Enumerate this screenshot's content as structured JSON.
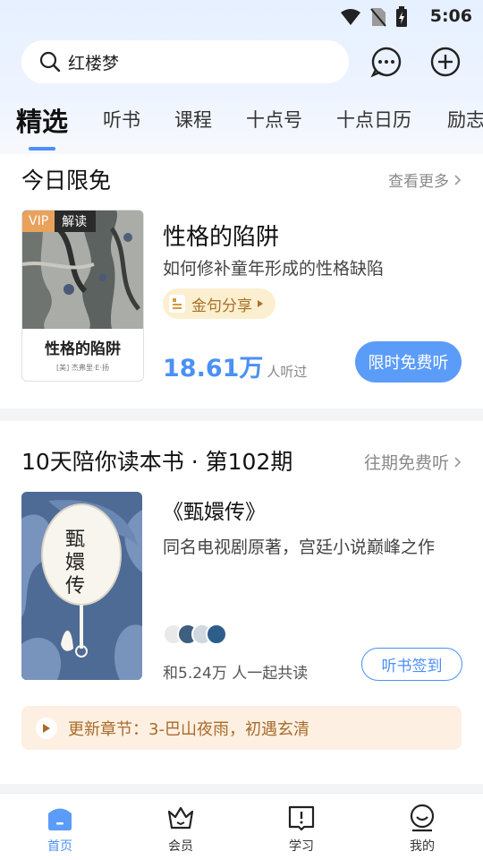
{
  "status_bar": {
    "time": "5:06"
  },
  "search": {
    "text": "红楼梦"
  },
  "tabs": [
    {
      "label": "精选",
      "active": true
    },
    {
      "label": "听书"
    },
    {
      "label": "课程"
    },
    {
      "label": "十点号"
    },
    {
      "label": "十点日历"
    },
    {
      "label": "励志"
    }
  ],
  "free_today": {
    "title": "今日限免",
    "more": "查看更多",
    "badge_vip": "VIP",
    "badge_type": "解读",
    "cover_title": "性格的陷阱",
    "cover_author": "[美] 杰弗里·E·扬",
    "book_title": "性格的陷阱",
    "book_subtitle": "如何修补童年形成的性格缺陷",
    "quote_chip": "金句分享",
    "listen_num": "18.61万",
    "listen_unit": "人听过",
    "free_button": "限时免费听"
  },
  "ten_days": {
    "title": "10天陪你读本书 · 第102期",
    "more": "往期免费听",
    "book_title": "《甄嬛传》",
    "book_subtitle": "同名电视剧原著，宫廷小说巅峰之作",
    "together": "和5.24万 人一起共读",
    "sign_button": "听书签到",
    "update": "更新章节：3-巴山夜雨，初遇玄清"
  },
  "bottom_nav": [
    {
      "label": "首页",
      "icon": "home-icon",
      "active": true
    },
    {
      "label": "会员",
      "icon": "crown-icon"
    },
    {
      "label": "学习",
      "icon": "book-icon"
    },
    {
      "label": "我的",
      "icon": "smile-icon"
    }
  ],
  "colors": {
    "accent": "#4a90f5",
    "vip": "#e8a25b",
    "update_text": "#a86b2a"
  }
}
